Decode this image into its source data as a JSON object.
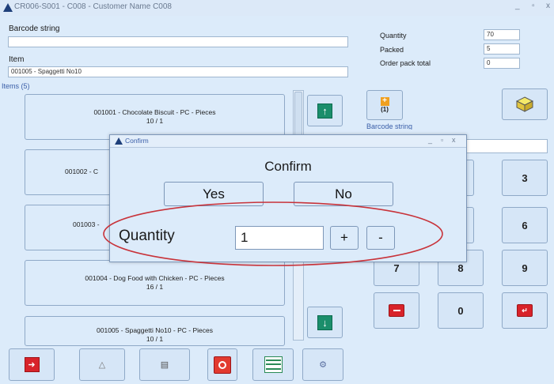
{
  "window": {
    "title": "CR006-S001 - C008 - Customer Name C008",
    "min": "_",
    "max": "▫",
    "close": "x"
  },
  "left": {
    "barcode_label": "Barcode string",
    "barcode_value": "",
    "item_label": "Item",
    "item_value": "001005 - Spaggetti No10",
    "items_header": "Items (5)",
    "items": [
      {
        "line1": "001001 - Chocolate Biscuit - PC - Pieces",
        "line2": "10 / 1"
      },
      {
        "line1": "001002 - C",
        "line2": ""
      },
      {
        "line1": "001003 -",
        "line2": ""
      },
      {
        "line1": "001004 - Dog Food with Chicken - PC - Pieces",
        "line2": "16 / 1"
      },
      {
        "line1": "001005 - Spaggetti No10 - PC - Pieces",
        "line2": "10 / 1"
      }
    ]
  },
  "right": {
    "quantity_label": "Quantity",
    "quantity_value": "70",
    "packed_label": "Packed",
    "packed_value": "5",
    "order_pack_label": "Order pack total",
    "order_pack_value": "0",
    "small_btn_label": "(1)",
    "barcode_label": "Barcode string",
    "keypad": [
      "3",
      "6",
      "7",
      "8",
      "9",
      "0"
    ]
  },
  "dialog": {
    "title": "Confirm",
    "heading": "Confirm",
    "yes_label": "Yes",
    "no_label": "No",
    "quantity_label": "Quantity",
    "quantity_value": "1",
    "plus_label": "+",
    "minus_label": "-",
    "min": "_",
    "max": "▫",
    "close": "x"
  },
  "colors": {
    "accent_green": "#1b8e6b",
    "accent_red": "#d8232a",
    "annotation_ellipse": "#c8333a",
    "background": "#dcebfa"
  },
  "icons": [
    "warning-logo-icon",
    "up-arrow-icon",
    "down-arrow-icon",
    "cube-icon",
    "plus-badge-icon",
    "minus-icon",
    "backspace-icon",
    "exit-icon",
    "lock-icon",
    "clipboard-icon",
    "cancel-icon",
    "list-icon",
    "settings-icon"
  ]
}
